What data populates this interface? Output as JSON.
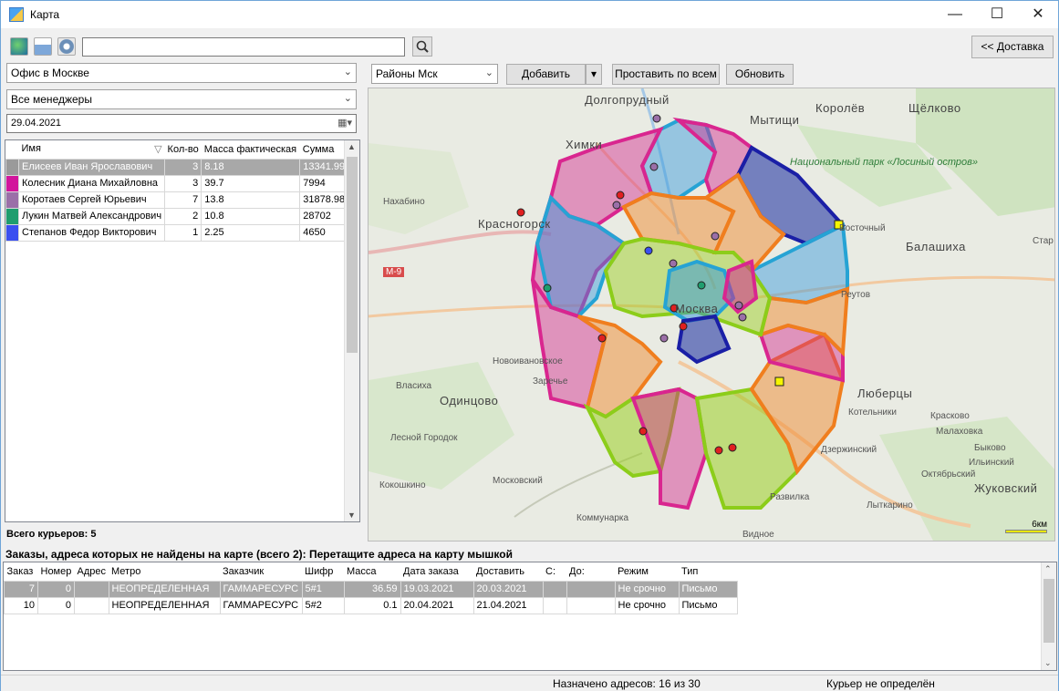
{
  "window": {
    "title": "Карта"
  },
  "toolbar": {
    "search_value": "",
    "delivery_button": "<< Доставка"
  },
  "left": {
    "office": "Офис в Москве",
    "managers": "Все менеджеры",
    "date": "29.04.2021",
    "columns": [
      "Имя",
      "Кол-во",
      "Масса фактическая",
      "Сумма"
    ],
    "rows": [
      {
        "color": "#9a9a9a",
        "name": "Елисеев Иван Ярославович",
        "qty": "3",
        "mass": "8.18",
        "sum": "13341.99",
        "selected": true
      },
      {
        "color": "#d2169c",
        "name": "Колесник Диана Михайловна",
        "qty": "3",
        "mass": "39.7",
        "sum": "7994",
        "selected": false
      },
      {
        "color": "#9b6fa8",
        "name": "Коротаев Сергей Юрьевич",
        "qty": "7",
        "mass": "13.8",
        "sum": "31878.98",
        "selected": false
      },
      {
        "color": "#1f9d6e",
        "name": "Лукин Матвей Александрович",
        "qty": "2",
        "mass": "10.8",
        "sum": "28702",
        "selected": false
      },
      {
        "color": "#3a4ff0",
        "name": "Степанов Федор Викторович",
        "qty": "1",
        "mass": "2.25",
        "sum": "4650",
        "selected": false
      }
    ],
    "total": "Всего курьеров: 5"
  },
  "mapbar": {
    "layer": "Районы Мск",
    "add": "Добавить",
    "assign_all": "Проставить по всем",
    "refresh": "Обновить"
  },
  "map": {
    "labels": {
      "dolgoprudny": "Долгопрудный",
      "mytishchi": "Мытищи",
      "korolev": "Королёв",
      "shchelkovo": "Щёлково",
      "khimki": "Химки",
      "park": "Национальный парк «Лосиный остров»",
      "krasnogorsk": "Красногорск",
      "balashikha": "Балашиха",
      "vostochny": "Восточный",
      "nakhabino": "Нахабино",
      "m9": "М-9",
      "moscow": "Москва",
      "reutov": "Реутов",
      "novoivankovo": "Новоивановское",
      "zarechye": "Заречье",
      "vlasikha": "Власиха",
      "odintsovo": "Одинцово",
      "lyubertsy": "Люберцы",
      "kotelniki": "Котельники",
      "kraskovo": "Красково",
      "lesnoy": "Лесной Городок",
      "malakhovka": "Малаховка",
      "dzerzhinsky": "Дзержинский",
      "bykovo": "Быково",
      "moskovsky": "Московский",
      "ilyinsky": "Ильинский",
      "kokoshkino": "Кокошкино",
      "oktyabrsky": "Октябрьский",
      "zhukovsky": "Жуковский",
      "vidnoe": "Видное",
      "lytkarino": "Лыткарино",
      "kommunarka": "Коммунарка",
      "zavidnoe": "Развилка",
      "star": "Стар",
      "scale": "6км"
    }
  },
  "unfound": {
    "title": "Заказы, адреса которых не найдены на карте (всего 2): Перетащите адреса на карту мышкой"
  },
  "orders": {
    "columns": [
      "Заказ",
      "Номер",
      "Адрес",
      "Метро",
      "Заказчик",
      "Шифр",
      "Масса",
      "Дата заказа",
      "Доставить",
      "С:",
      "До:",
      "Режим",
      "Тип"
    ],
    "rows": [
      {
        "order": "7",
        "num": "0",
        "addr": "",
        "metro": "НЕОПРЕДЕЛЕННАЯ",
        "client": "ГАММАРЕСУРС",
        "code": "5#1",
        "mass": "36.59",
        "date": "19.03.2021",
        "deliver": "20.03.2021",
        "from": "",
        "to": "",
        "mode": "Не срочно",
        "type": "Письмо",
        "selected": true
      },
      {
        "order": "10",
        "num": "0",
        "addr": "",
        "metro": "НЕОПРЕДЕЛЕННАЯ",
        "client": "ГАММАРЕСУРС",
        "code": "5#2",
        "mass": "0.1",
        "date": "20.04.2021",
        "deliver": "21.04.2021",
        "from": "",
        "to": "",
        "mode": "Не срочно",
        "type": "Письмо",
        "selected": false
      }
    ]
  },
  "status": {
    "assigned": "Назначено адресов: 16 из 30",
    "courier": "Курьер не определён"
  }
}
